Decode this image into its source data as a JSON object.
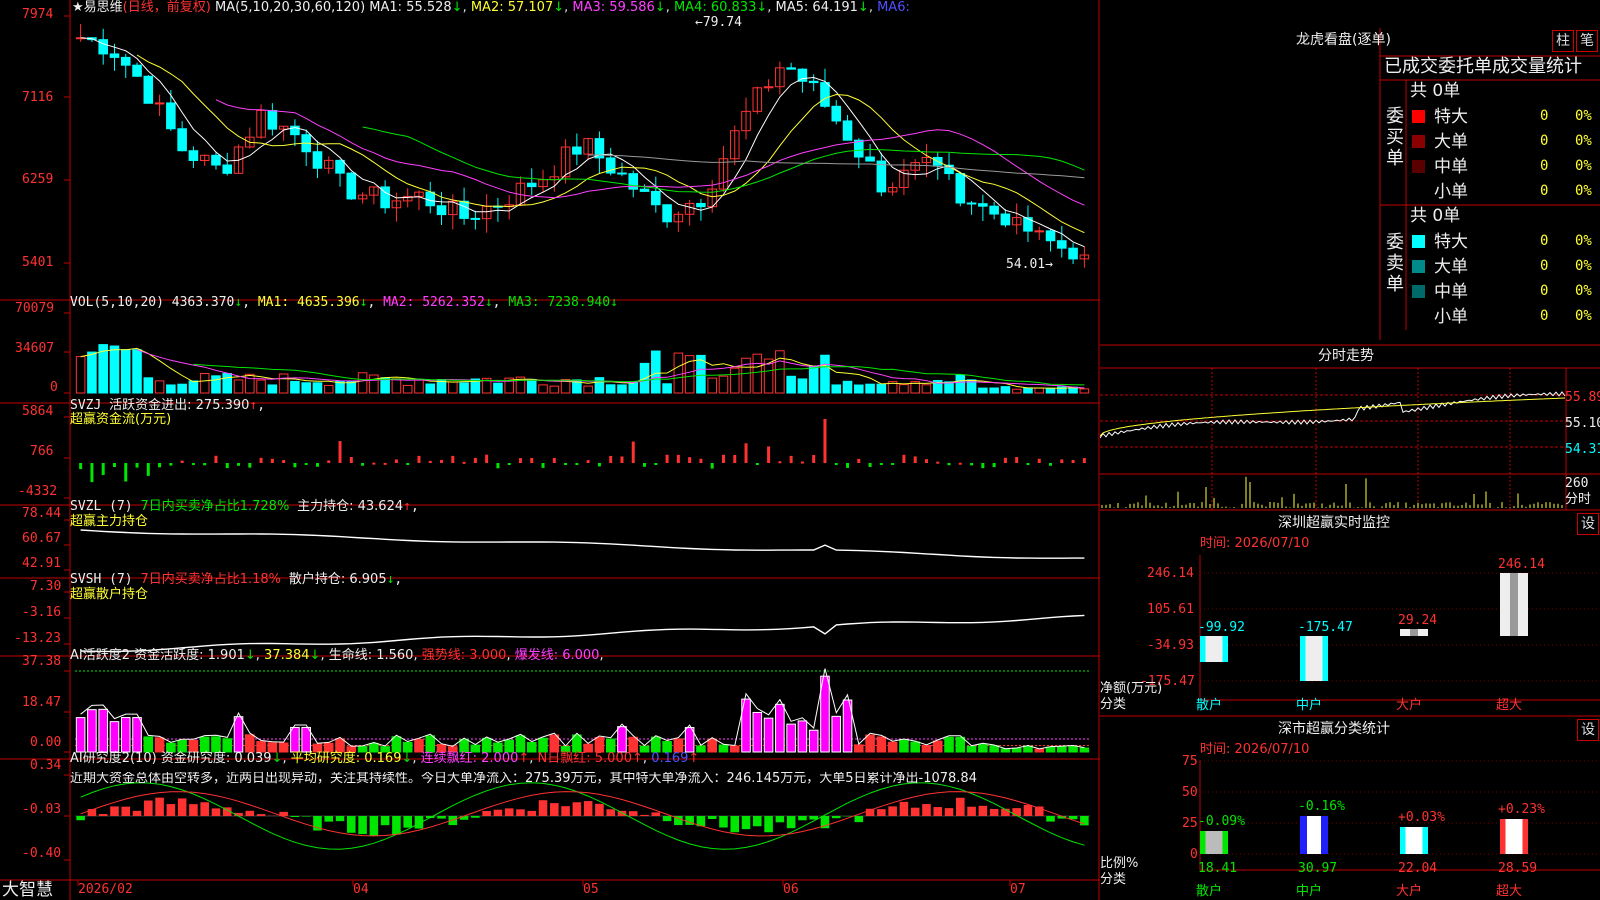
{
  "colors": {
    "up": "#ff3232",
    "down": "#00ffff",
    "border": "#c00000",
    "axis": "#ff3232"
  },
  "header": {
    "stock": "易思维",
    "period": "(日线，前复权)",
    "ma_title": "MA(5,10,20,30,60,120)",
    "ma1": "MA1: 55.528",
    "ma2": "MA2: 57.107",
    "ma3": "MA3: 59.586",
    "ma4": "MA4: 60.833",
    "ma5": "MA5: 64.191",
    "ma6": "MA6:",
    "high_label": "79.74",
    "low_label": "54.01"
  },
  "price_axis": [
    "7974",
    "7116",
    "6259",
    "5401"
  ],
  "vol": {
    "title": "VOL(5,10,20)",
    "val": "4363.370",
    "ma1": "MA1: 4635.396",
    "ma2": "MA2: 5262.352",
    "ma3": "MA3: 7238.940",
    "axis": [
      "70079",
      "34607",
      "0"
    ]
  },
  "svzj": {
    "title": "SVZJ",
    "label": "活跃资金进出: 275.390",
    "sub": "超赢资金流(万元)",
    "axis": [
      "5864",
      "766",
      "-4332"
    ]
  },
  "svzl": {
    "title": "SVZL (7)",
    "l1": "7日内买卖净占比1.728%",
    "l2": "主力持仓: 43.624",
    "sub": "超赢主力持仓",
    "axis": [
      "78.44",
      "60.67",
      "42.91"
    ]
  },
  "svsh": {
    "title": "SVSH (7)",
    "l1": "7日内买卖净占比1.18%",
    "l2": "散户持仓: 6.905",
    "sub": "超赢散户持仓",
    "axis": [
      "7.30",
      "-3.16",
      "-13.23"
    ]
  },
  "ai2": {
    "title": "AI活跃度2",
    "l1": "资金活跃度: 1.901",
    "l2": "37.384",
    "l3": "生命线: 1.560",
    "l4": "强势线: 3.000",
    "l5": "爆发线: 6.000",
    "axis": [
      "37.38",
      "18.47",
      "0.00"
    ]
  },
  "ai_study": {
    "title": "AI研究度2(10)",
    "l1": "资金研究度: 0.039",
    "l2": "平均研究度: 0.169",
    "l3": "连续飘红: 2.000",
    "l4": "N日飘红: 5.000",
    "l5": "0.169",
    "note": "近期大资金总体由空转多，近两日出现异动，关注其持续性。今日大单净流入：275.39万元，其中特大单净流入：246.145万元，大单5日累计净出-1078.84",
    "axis": [
      "0.34",
      "-0.03",
      "-0.40"
    ]
  },
  "date_axis": [
    "2026/02",
    "04",
    "05",
    "06",
    "07"
  ],
  "brand": "大智慧",
  "dragon": {
    "title": "龙虎看盘(逐单)",
    "btn1": "柱",
    "btn2": "笔",
    "stats_title": "已成交委托单成交量统计",
    "buy_label": "委买单",
    "sell_label": "委卖单",
    "buy_total": "共 0单",
    "sell_total": "共 0单",
    "buy_rows": [
      {
        "name": "特大",
        "val": "0",
        "pct": "0%",
        "color": "#ff0000"
      },
      {
        "name": "大单",
        "val": "0",
        "pct": "0%",
        "color": "#8b0000"
      },
      {
        "name": "中单",
        "val": "0",
        "pct": "0%",
        "color": "#5a0000"
      },
      {
        "name": "小单",
        "val": "0",
        "pct": "0%",
        "color": "#000"
      }
    ],
    "sell_rows": [
      {
        "name": "特大",
        "val": "0",
        "pct": "0%",
        "color": "#00ffff"
      },
      {
        "name": "大单",
        "val": "0",
        "pct": "0%",
        "color": "#008b8b"
      },
      {
        "name": "中单",
        "val": "0",
        "pct": "0%",
        "color": "#006a6a"
      },
      {
        "name": "小单",
        "val": "0",
        "pct": "0%",
        "color": "#000"
      }
    ]
  },
  "intraday": {
    "title": "分时走势",
    "axis": [
      "55.89",
      "55.10",
      "54.31"
    ],
    "vol_label": "260",
    "vol_unit": "分时"
  },
  "monitor": {
    "title": "深圳超赢实时监控",
    "btn": "设",
    "time": "时间: 2026/07/10",
    "axis": [
      "246.14",
      "105.61",
      "-34.93",
      "-175.47"
    ],
    "unit": "净额(万元)",
    "cat_label": "分类"
  },
  "classify": {
    "title": "深市超赢分类统计",
    "btn": "设",
    "time": "时间: 2026/07/10",
    "axis": [
      "75",
      "50",
      "25",
      "0"
    ],
    "unit": "比例%",
    "cat_label": "分类"
  },
  "chart_data": [
    {
      "type": "bar",
      "title": "深圳超赢实时监控",
      "categories": [
        "散户",
        "中户",
        "大户",
        "超大"
      ],
      "values": [
        -99.92,
        -175.47,
        29.24,
        246.14
      ],
      "ylabel": "净额(万元)",
      "ylim": [
        -175.47,
        246.14
      ]
    },
    {
      "type": "bar",
      "title": "深市超赢分类统计",
      "categories": [
        "散户",
        "中户",
        "大户",
        "超大"
      ],
      "values": [
        18.41,
        30.97,
        22.04,
        28.59
      ],
      "changes": [
        "-0.09%",
        "-0.16%",
        "+0.03%",
        "+0.23%"
      ],
      "ylabel": "比例%",
      "ylim": [
        0,
        75
      ]
    }
  ]
}
